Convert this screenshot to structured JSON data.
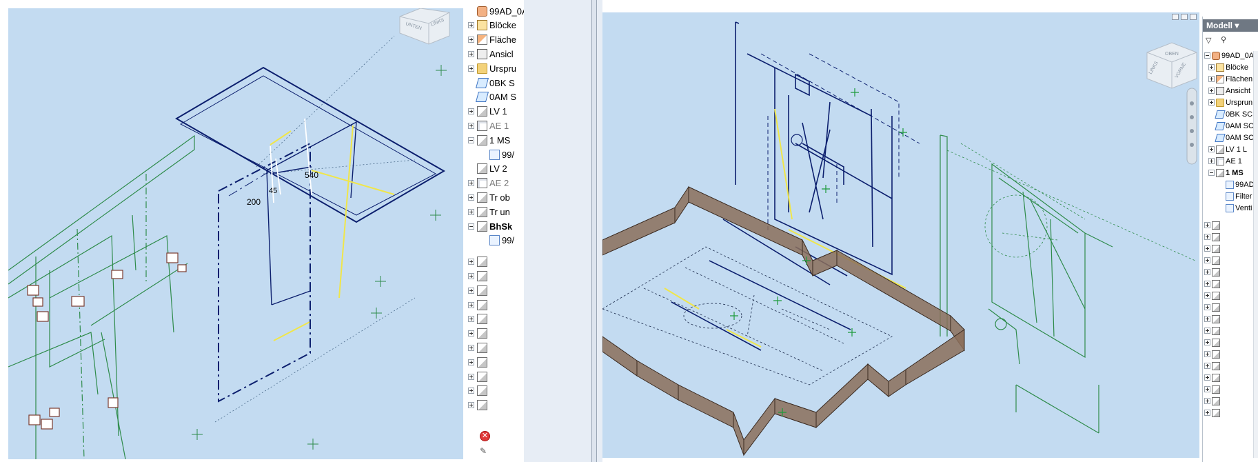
{
  "left_viewport": {
    "viewcube": {
      "face_1": "UNTEN",
      "face_2": "LINKS"
    },
    "dimension_labels": [
      "200",
      "540",
      "45"
    ]
  },
  "left_tree": {
    "items": [
      {
        "label": "99AD_0A",
        "icon": "root-icon"
      },
      {
        "label": "Blöcke",
        "icon": "blocks-icon"
      },
      {
        "label": "Fläche",
        "icon": "surfaces-icon"
      },
      {
        "label": "Ansicl",
        "icon": "views-icon"
      },
      {
        "label": "Urspru",
        "icon": "folder-icon"
      },
      {
        "label": "0BK S",
        "icon": "layer-icon"
      },
      {
        "label": "0AM S",
        "icon": "layer-icon"
      },
      {
        "label": "LV 1",
        "icon": "sketch-icon"
      },
      {
        "label": "AE 1",
        "icon": "cube-icon"
      },
      {
        "label": "1 MS",
        "icon": "sketch-icon"
      },
      {
        "label": "99/",
        "icon": "document-icon"
      },
      {
        "label": "LV 2",
        "icon": "sketch-icon"
      },
      {
        "label": "AE 2",
        "icon": "cube-icon"
      },
      {
        "label": "Tr ob",
        "icon": "sketch-icon"
      },
      {
        "label": "Tr un",
        "icon": "sketch-icon"
      },
      {
        "label": "BhSk",
        "icon": "sketch-icon"
      },
      {
        "label": "99/",
        "icon": "document-icon"
      }
    ],
    "error_icon": "error-icon",
    "bottom_icon": "edit-icon"
  },
  "right_viewport": {
    "viewcube": {
      "face_1": "OBEN",
      "face_2": "LINKS",
      "face_3": "VORNE"
    }
  },
  "right_tree": {
    "dropdown_label": "Modell",
    "items": [
      {
        "label": "99AD_0A C",
        "icon": "root-icon"
      },
      {
        "label": "Blöcke",
        "icon": "blocks-icon"
      },
      {
        "label": "Flächen",
        "icon": "surfaces-icon"
      },
      {
        "label": "Ansicht",
        "icon": "views-icon"
      },
      {
        "label": "Ursprun",
        "icon": "folder-icon"
      },
      {
        "label": "0BK SC",
        "icon": "layer-icon"
      },
      {
        "label": "0AM SC",
        "icon": "layer-icon"
      },
      {
        "label": "0AM SC",
        "icon": "layer-icon"
      },
      {
        "label": "LV 1 L",
        "icon": "sketch-icon"
      },
      {
        "label": "AE 1",
        "icon": "cube-icon"
      },
      {
        "label": "1 MS",
        "icon": "sketch-icon"
      },
      {
        "label": "99AD",
        "icon": "document-icon"
      },
      {
        "label": "Filter",
        "icon": "document-icon"
      },
      {
        "label": "Venti",
        "icon": "document-icon"
      }
    ]
  },
  "colors": {
    "viewport_bg": "#c3dbf1",
    "navy_edges": "#0c1f6e",
    "green_lines": "#2e8b4a",
    "yellow_lines": "#f0e64a",
    "wall_brown": "#8b6f5a"
  }
}
